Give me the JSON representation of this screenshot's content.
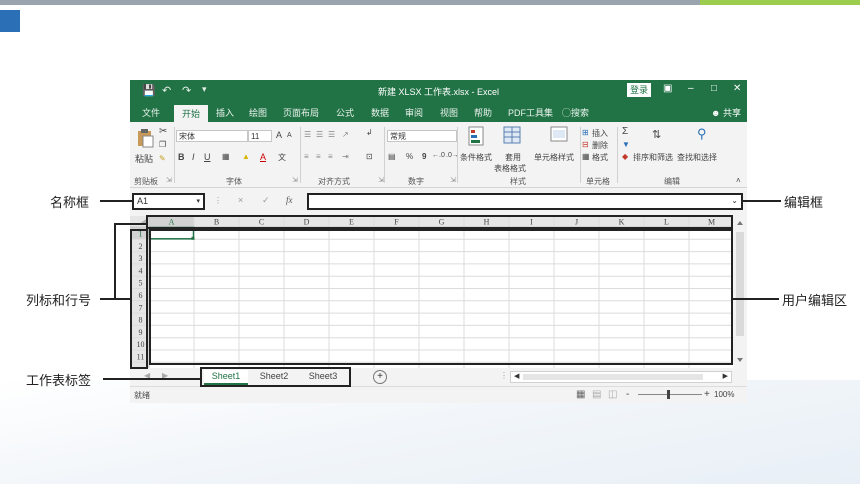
{
  "window": {
    "title": "新建 XLSX 工作表.xlsx - Excel",
    "login_label": "登录",
    "share_label": "共享"
  },
  "tabs": [
    "文件",
    "开始",
    "插入",
    "绘图",
    "页面布局",
    "公式",
    "数据",
    "审阅",
    "视图",
    "帮助",
    "PDF工具集",
    "搜索"
  ],
  "active_tab": "开始",
  "ribbon": {
    "clipboard": {
      "paste": "粘贴",
      "group": "剪贴板"
    },
    "font": {
      "font_name": "宋体",
      "font_size": "11",
      "bold": "B",
      "italic": "I",
      "underline": "U",
      "grow": "A",
      "shrink": "A",
      "color_a": "A",
      "group": "字体"
    },
    "alignment": {
      "group": "对齐方式"
    },
    "number": {
      "format": "常规",
      "percent": "%",
      "comma": "9",
      "group": "数字"
    },
    "styles": {
      "conditional": "条件格式",
      "table_format_1": "套用",
      "table_format_2": "表格格式",
      "cell_styles": "单元格样式",
      "group": "样式"
    },
    "cells": {
      "insert": "插入",
      "delete": "删除",
      "format": "格式",
      "group": "单元格"
    },
    "editing": {
      "sum": "Σ",
      "sort_filter": "排序和筛选",
      "find_select": "查找和选择",
      "group": "编辑"
    }
  },
  "formula_bar": {
    "name_box": "A1",
    "fx": "fx",
    "cancel": "×",
    "confirm": "✓",
    "value": ""
  },
  "columns": [
    "A",
    "B",
    "C",
    "D",
    "E",
    "F",
    "G",
    "H",
    "I",
    "J",
    "K",
    "L",
    "M"
  ],
  "rows": [
    "1",
    "2",
    "3",
    "4",
    "5",
    "6",
    "7",
    "8",
    "9",
    "10",
    "11"
  ],
  "sheets": [
    "Sheet1",
    "Sheet2",
    "Sheet3"
  ],
  "active_sheet": "Sheet1",
  "add_sheet": "+",
  "status": {
    "ready": "就绪",
    "zoom": "100%",
    "zoom_out": "-",
    "zoom_in": "+"
  },
  "callouts": {
    "name_box": "名称框",
    "headers": "列标和行号",
    "sheet_tabs": "工作表标签",
    "formula_bar": "编辑框",
    "user_area": "用户编辑区"
  },
  "colors": {
    "excel_green": "#217346",
    "slide_blue": "#2b6fb6",
    "slide_lime": "#9ccd4f"
  }
}
